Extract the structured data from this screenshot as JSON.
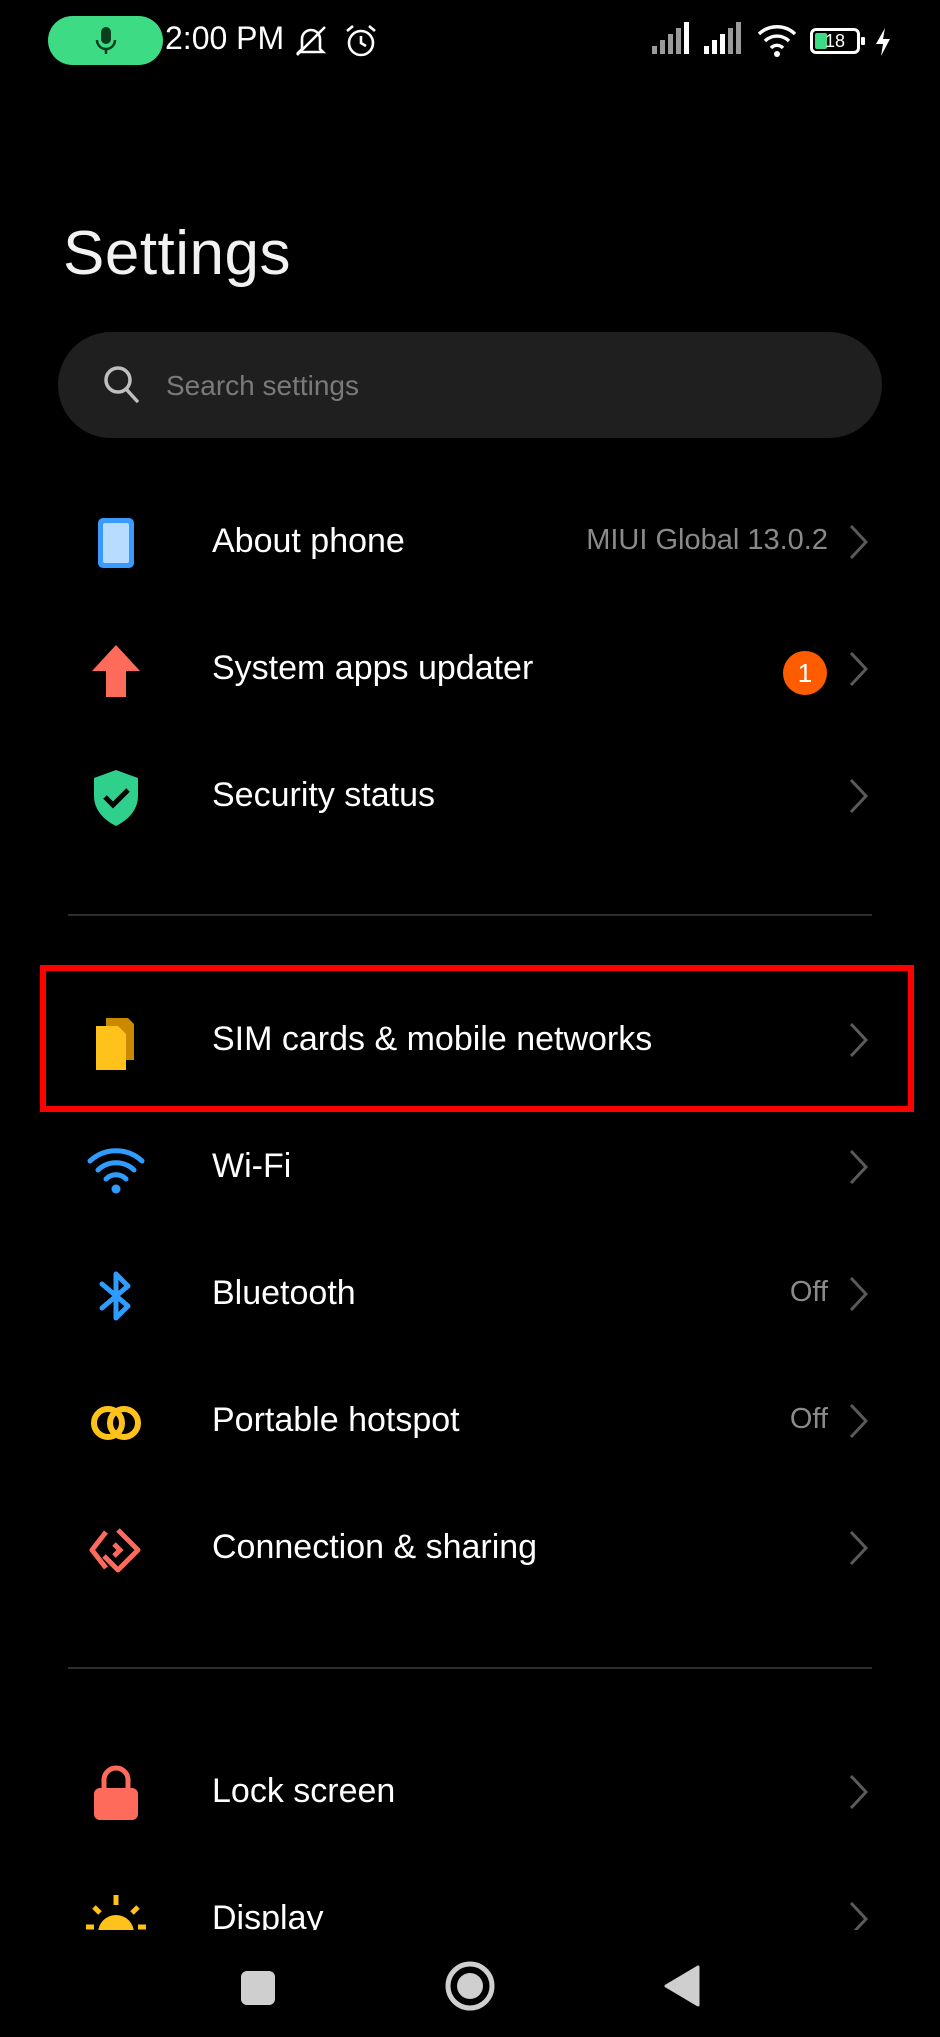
{
  "status_bar": {
    "time": "2:00 PM",
    "battery": "18",
    "accent_color": "#3ddc84"
  },
  "header": {
    "title": "Settings"
  },
  "search": {
    "placeholder": "Search settings"
  },
  "items": [
    {
      "label": "About phone",
      "value": "MIUI Global 13.0.2",
      "icon": "phone-icon"
    },
    {
      "label": "System apps updater",
      "badge": "1",
      "icon": "arrow-up-icon"
    },
    {
      "label": "Security status",
      "icon": "shield-check-icon"
    },
    {
      "label": "SIM cards & mobile networks",
      "icon": "sim-card-icon"
    },
    {
      "label": "Wi-Fi",
      "icon": "wifi-icon"
    },
    {
      "label": "Bluetooth",
      "value": "Off",
      "icon": "bluetooth-icon"
    },
    {
      "label": "Portable hotspot",
      "value": "Off",
      "icon": "hotspot-icon"
    },
    {
      "label": "Connection & sharing",
      "icon": "connection-sharing-icon"
    },
    {
      "label": "Lock screen",
      "icon": "lock-icon"
    },
    {
      "label": "Display",
      "icon": "sun-icon"
    }
  ],
  "colors": {
    "highlight": "#ff0000",
    "badge": "#ff5c00",
    "background": "#000000"
  }
}
